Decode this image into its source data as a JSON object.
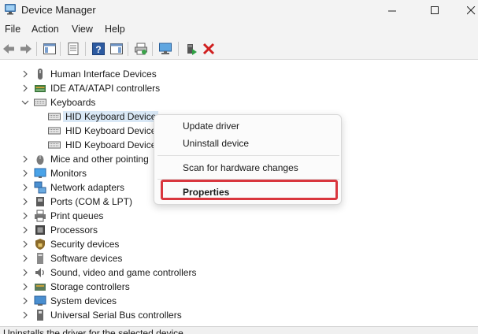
{
  "window": {
    "title": "Device Manager",
    "minimize_glyph": "—",
    "maximize_glyph": "☐",
    "close_glyph": "✕"
  },
  "menu": [
    {
      "label": "File"
    },
    {
      "label": "Action"
    },
    {
      "label": "View"
    },
    {
      "label": "Help"
    }
  ],
  "toolbar": {
    "icons": [
      "back-arrow-icon",
      "forward-arrow-icon",
      "show-hide-console-tree-icon",
      "properties-icon",
      "help-icon",
      "action-pane-icon",
      "print-icon",
      "monitor-icon",
      "update-driver-icon",
      "uninstall-x-icon"
    ]
  },
  "tree": {
    "rows": [
      {
        "label": "Human Interface Devices",
        "icon": "hid-icon",
        "expanded": false
      },
      {
        "label": "IDE ATA/ATAPI controllers",
        "icon": "ide-icon",
        "expanded": false
      },
      {
        "label": "Keyboards",
        "icon": "keyboard-icon",
        "expanded": true
      },
      {
        "label": "HID Keyboard Device",
        "icon": "keyboard-icon",
        "child": true,
        "selected": true
      },
      {
        "label": "HID Keyboard Device",
        "icon": "keyboard-icon",
        "child": true
      },
      {
        "label": "HID Keyboard Device",
        "icon": "keyboard-icon",
        "child": true
      },
      {
        "label": "Mice and other pointing",
        "icon": "mouse-icon",
        "expanded": false
      },
      {
        "label": "Monitors",
        "icon": "monitor-icon",
        "expanded": false
      },
      {
        "label": "Network adapters",
        "icon": "network-icon",
        "expanded": false
      },
      {
        "label": "Ports (COM & LPT)",
        "icon": "port-icon",
        "expanded": false
      },
      {
        "label": "Print queues",
        "icon": "printer-icon",
        "expanded": false
      },
      {
        "label": "Processors",
        "icon": "processor-icon",
        "expanded": false
      },
      {
        "label": "Security devices",
        "icon": "security-icon",
        "expanded": false
      },
      {
        "label": "Software devices",
        "icon": "software-icon",
        "expanded": false
      },
      {
        "label": "Sound, video and game controllers",
        "icon": "sound-icon",
        "expanded": false
      },
      {
        "label": "Storage controllers",
        "icon": "storage-icon",
        "expanded": false
      },
      {
        "label": "System devices",
        "icon": "system-icon",
        "expanded": false
      },
      {
        "label": "Universal Serial Bus controllers",
        "icon": "usb-icon",
        "expanded": false
      }
    ]
  },
  "context_menu": {
    "items": [
      {
        "label": "Update driver"
      },
      {
        "label": "Uninstall device"
      },
      {
        "label": "Scan for hardware changes"
      },
      {
        "label": "Properties",
        "highlighted": true
      }
    ],
    "highlight_color": "#d9363e"
  },
  "status": {
    "text": "Uninstalls the driver for the selected device."
  },
  "colors": {
    "selection": "#d9e8f6",
    "chrome": "#f3f3f3"
  }
}
